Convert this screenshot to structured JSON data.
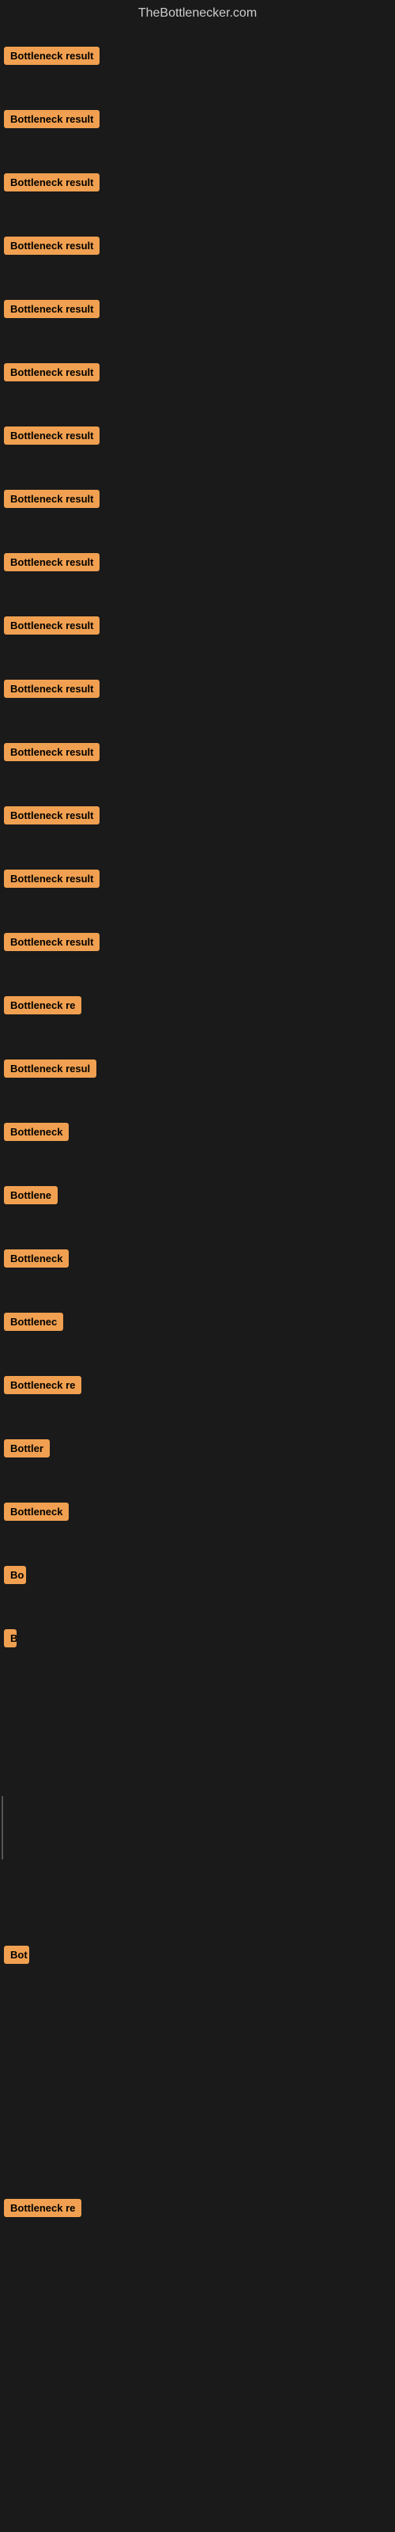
{
  "site": {
    "title": "TheBottlenecker.com"
  },
  "results": [
    {
      "label": "Bottleneck result",
      "width": 130
    },
    {
      "label": "Bottleneck result",
      "width": 130
    },
    {
      "label": "Bottleneck result",
      "width": 130
    },
    {
      "label": "Bottleneck result",
      "width": 130
    },
    {
      "label": "Bottleneck result",
      "width": 130
    },
    {
      "label": "Bottleneck result",
      "width": 130
    },
    {
      "label": "Bottleneck result",
      "width": 130
    },
    {
      "label": "Bottleneck result",
      "width": 130
    },
    {
      "label": "Bottleneck result",
      "width": 130
    },
    {
      "label": "Bottleneck result",
      "width": 130
    },
    {
      "label": "Bottleneck result",
      "width": 130
    },
    {
      "label": "Bottleneck result",
      "width": 130
    },
    {
      "label": "Bottleneck result",
      "width": 130
    },
    {
      "label": "Bottleneck result",
      "width": 130
    },
    {
      "label": "Bottleneck result",
      "width": 125
    },
    {
      "label": "Bottleneck re",
      "width": 105
    },
    {
      "label": "Bottleneck resul",
      "width": 118
    },
    {
      "label": "Bottleneck",
      "width": 85
    },
    {
      "label": "Bottlene",
      "width": 72
    },
    {
      "label": "Bottleneck",
      "width": 85
    },
    {
      "label": "Bottlenec",
      "width": 78
    },
    {
      "label": "Bottleneck re",
      "width": 105
    },
    {
      "label": "Bottler",
      "width": 60
    },
    {
      "label": "Bottleneck",
      "width": 85
    },
    {
      "label": "Bo",
      "width": 28
    },
    {
      "label": "B",
      "width": 14
    },
    {
      "label": "",
      "width": 0
    },
    {
      "label": "",
      "width": 0
    },
    {
      "label": "|",
      "width": 10
    },
    {
      "label": "",
      "width": 0
    },
    {
      "label": "Bot",
      "width": 32
    },
    {
      "label": "",
      "width": 0
    },
    {
      "label": "",
      "width": 0
    },
    {
      "label": "",
      "width": 0
    },
    {
      "label": "Bottleneck re",
      "width": 105
    },
    {
      "label": "",
      "width": 0
    },
    {
      "label": "",
      "width": 0
    },
    {
      "label": "",
      "width": 0
    }
  ]
}
